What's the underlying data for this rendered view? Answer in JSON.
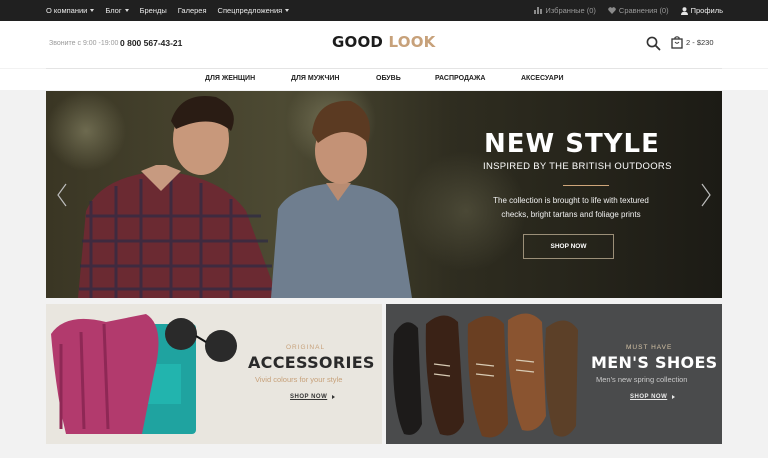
{
  "topbar": {
    "nav": [
      {
        "label": "О компании",
        "dropdown": true
      },
      {
        "label": "Блог",
        "dropdown": true
      },
      {
        "label": "Бренды",
        "dropdown": false
      },
      {
        "label": "Галерея",
        "dropdown": false
      },
      {
        "label": "Спецпредложения",
        "dropdown": true
      }
    ],
    "favorites": "Избранные (0)",
    "compare": "Сравнения (0)",
    "profile": "Профиль"
  },
  "header": {
    "call_hours": "Звоните с 9:00 -19:00",
    "phone": "0 800 567-43-21",
    "logo_part1": "GOOD",
    "logo_part2": "LOOK",
    "cart_summary": "2 - $230"
  },
  "main_nav": [
    "ДЛЯ ЖЕНЩИН",
    "ДЛЯ МУЖЧИН",
    "ОБУВЬ",
    "РАСПРОДАЖА",
    "АКСЕСУАРИ"
  ],
  "hero": {
    "title": "NEW STYLE",
    "subtitle": "INSPIRED BY THE BRITISH OUTDOORS",
    "desc_line1": "The collection is brought to life with textured",
    "desc_line2": "checks, bright tartans and foliage prints",
    "button": "SHOP NOW"
  },
  "banners": {
    "accessories": {
      "kicker": "ORIGINAL",
      "title": "ACCESSORIES",
      "sub": "Vivid colours for your style",
      "link": "SHOP NOW"
    },
    "shoes": {
      "kicker": "MUST HAVE",
      "title": "MEN'S SHOES",
      "sub": "Men's new spring collection",
      "link": "SHOP NOW"
    }
  },
  "colors": {
    "accent": "#c7a17a",
    "topbar": "#202020",
    "background": "#f2f2f2"
  }
}
